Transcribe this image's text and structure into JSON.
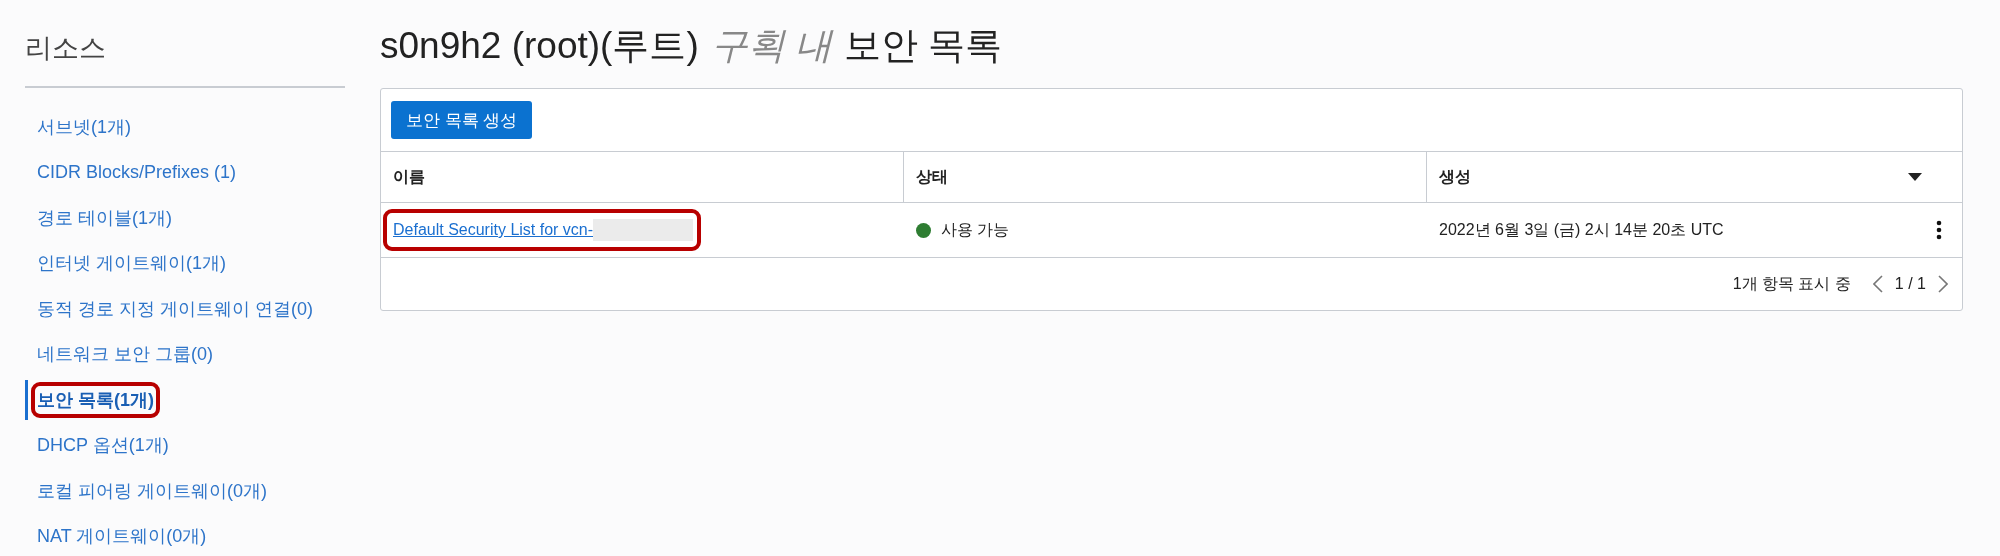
{
  "sidebar": {
    "title": "리소스",
    "items": [
      {
        "label": "서브넷(1개)",
        "selected": false,
        "highlighted": false
      },
      {
        "label": "CIDR Blocks/Prefixes (1)",
        "selected": false,
        "highlighted": false
      },
      {
        "label": "경로 테이블(1개)",
        "selected": false,
        "highlighted": false
      },
      {
        "label": "인터넷 게이트웨이(1개)",
        "selected": false,
        "highlighted": false
      },
      {
        "label": "동적 경로 지정 게이트웨이 연결(0)",
        "selected": false,
        "highlighted": false
      },
      {
        "label": "네트워크 보안 그룹(0)",
        "selected": false,
        "highlighted": false
      },
      {
        "label": "보안 목록(1개)",
        "selected": true,
        "highlighted": true
      },
      {
        "label": "DHCP 옵션(1개)",
        "selected": false,
        "highlighted": false
      },
      {
        "label": "로컬 피어링 게이트웨이(0개)",
        "selected": false,
        "highlighted": false
      },
      {
        "label": "NAT 게이트웨이(0개)",
        "selected": false,
        "highlighted": false
      }
    ]
  },
  "page_title": {
    "name": "s0n9h2 (root)(루트)",
    "scope": "구획 내",
    "subject": "보안 목록"
  },
  "create_button": "보안 목록 생성",
  "table": {
    "columns": [
      {
        "label": "이름",
        "sortable": false
      },
      {
        "label": "상태",
        "sortable": false
      },
      {
        "label": "생성",
        "sortable": true
      }
    ],
    "rows": [
      {
        "name": "Default Security List for vcn-",
        "redacted": true,
        "highlighted": true,
        "status": "사용 가능",
        "color": "#2e7d32",
        "created": "2022년 6월 3일 (금) 2시 14분 20초 UTC"
      }
    ]
  },
  "footer": {
    "count": "1개 항목 표시 중",
    "page": "1 / 1"
  }
}
